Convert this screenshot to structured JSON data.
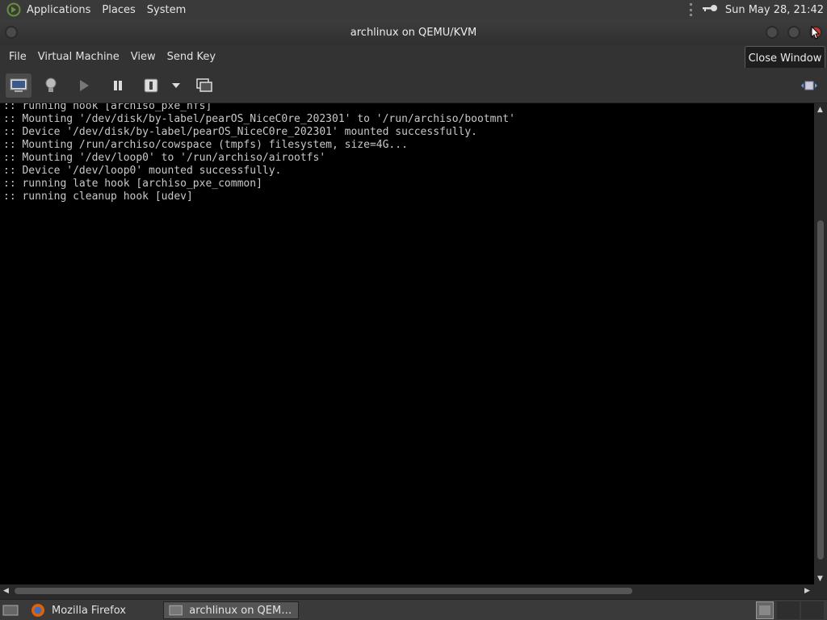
{
  "top_panel": {
    "menus": [
      "Applications",
      "Places",
      "System"
    ],
    "datetime": "Sun May 28, 21:42"
  },
  "window": {
    "title": "archlinux on QEMU/KVM"
  },
  "menubar": {
    "items": [
      "File",
      "Virtual Machine",
      "View",
      "Send Key"
    ]
  },
  "toolbar": {
    "icons": [
      "monitor-icon",
      "lightbulb-icon",
      "play-icon",
      "pause-icon",
      "power-icon",
      "chevron-down-icon",
      "snapshot-icon",
      "fullscreen-icon"
    ]
  },
  "tooltip": {
    "text": "Close Window"
  },
  "console": {
    "lines": [
      ":: running hook [archiso_pxe_nfs]",
      ":: Mounting '/dev/disk/by-label/pearOS_NiceC0re_202301' to '/run/archiso/bootmnt'",
      ":: Device '/dev/disk/by-label/pearOS_NiceC0re_202301' mounted successfully.",
      ":: Mounting /run/archiso/cowspace (tmpfs) filesystem, size=4G...",
      ":: Mounting '/dev/loop0' to '/run/archiso/airootfs'",
      ":: Device '/dev/loop0' mounted successfully.",
      ":: running late hook [archiso_pxe_common]",
      ":: running cleanup hook [udev]"
    ]
  },
  "taskbar": {
    "tasks": [
      {
        "label": "Mozilla Firefox"
      },
      {
        "label": "archlinux on QEMU/..."
      }
    ]
  },
  "colors": {
    "panel_bg": "#3a3a3a",
    "console_bg": "#000000",
    "console_text": "#c8c8c8",
    "close_button": "#c23a2c"
  }
}
